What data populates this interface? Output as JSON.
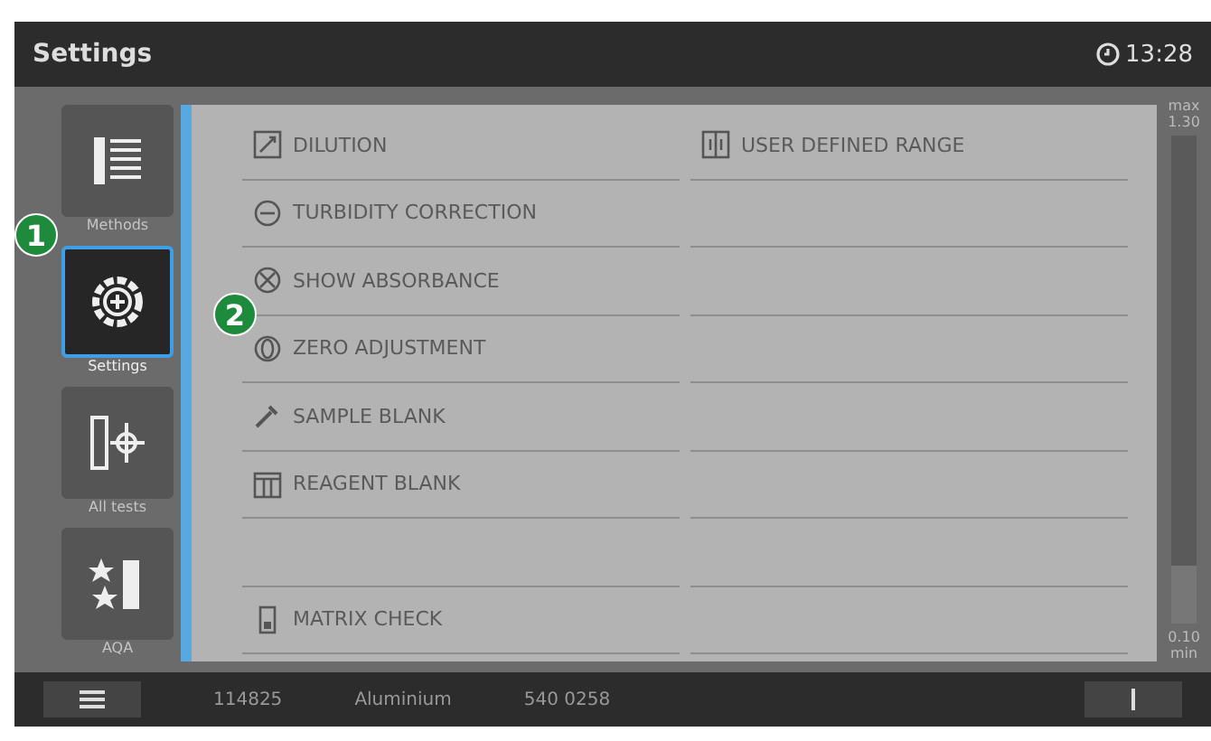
{
  "header": {
    "title": "Settings",
    "time": "13:28"
  },
  "sidebar": {
    "items": [
      {
        "label": "Methods",
        "kind": "list",
        "selected": false
      },
      {
        "label": "Settings",
        "kind": "gear",
        "selected": true
      },
      {
        "label": "All tests",
        "kind": "scale",
        "selected": false
      },
      {
        "label": "AQA",
        "kind": "stars",
        "selected": false
      }
    ]
  },
  "callouts": [
    "1",
    "2"
  ],
  "left_column": [
    {
      "label": "DILUTION",
      "kind": "dilution"
    },
    {
      "label": "TURBIDITY CORRECTION",
      "kind": "turbidity"
    },
    {
      "label": "SHOW ABSORBANCE",
      "kind": "absorbance"
    },
    {
      "label": "ZERO ADJUSTMENT",
      "kind": "zero"
    },
    {
      "label": "SAMPLE BLANK",
      "kind": "pipette"
    },
    {
      "label": "REAGENT BLANK",
      "kind": "reagent"
    },
    {
      "kind": "empty"
    },
    {
      "label": "MATRIX CHECK",
      "kind": "matrix"
    }
  ],
  "right_column": [
    {
      "label": "USER DEFINED RANGE",
      "kind": "range"
    },
    {
      "kind": "empty"
    },
    {
      "kind": "empty"
    },
    {
      "kind": "empty"
    },
    {
      "kind": "empty"
    },
    {
      "kind": "empty"
    },
    {
      "kind": "empty"
    },
    {
      "kind": "empty"
    }
  ],
  "meter": {
    "max_label": "max",
    "max_value": "1.30",
    "min_value": "0.10",
    "min_label": "min",
    "level": 0.12
  },
  "status_bar": {
    "method": "114825",
    "parameter": "Aluminium",
    "serial": "540 0258"
  }
}
